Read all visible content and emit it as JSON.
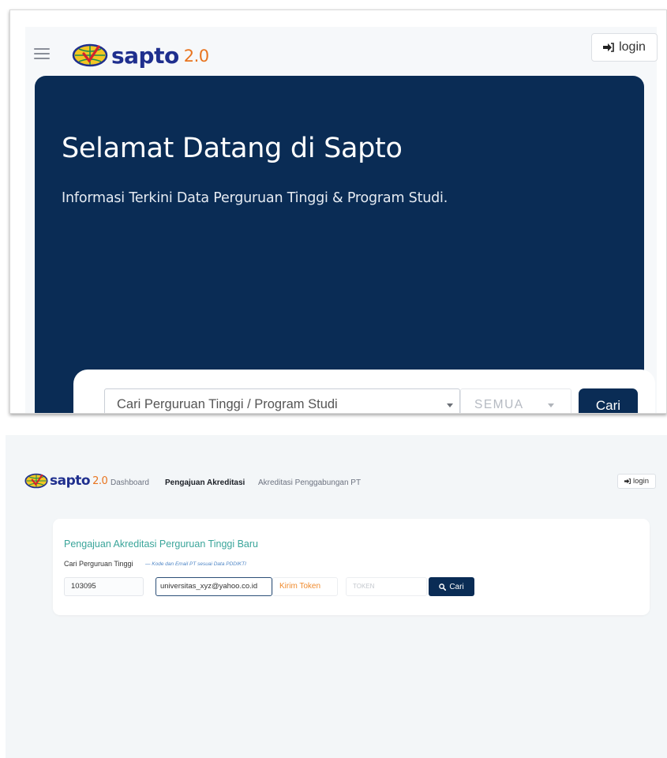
{
  "top_screen": {
    "brand": {
      "word": "sapto",
      "version": "2.0"
    },
    "login_label": "login",
    "hero": {
      "title": "Selamat Datang di Sapto",
      "subtitle": "Informasi Terkini Data Perguruan Tinggi & Program Studi."
    },
    "search": {
      "placeholder": "Cari Perguruan Tinggi / Program Studi",
      "filter_value": "SEMUA",
      "button_label": "Cari"
    },
    "icons": {
      "menu": "hamburger-menu-icon",
      "login": "sign-in-icon",
      "logo": "globe-check-logo-icon",
      "dropdown": "chevron-down-icon"
    },
    "colors": {
      "navy": "#0a2c55",
      "brand_blue": "#1f2f8e",
      "brand_orange": "#e8741f"
    }
  },
  "bottom_screen": {
    "brand": {
      "word": "sapto",
      "version": "2.0"
    },
    "nav": [
      "Dashboard",
      "Pengajuan Akreditasi",
      "Akreditasi Penggabungan PT"
    ],
    "active_nav": "Pengajuan Akreditasi",
    "login_label": "login",
    "card": {
      "title": "Pengajuan Akreditasi Perguruan Tinggi Baru",
      "label": "Cari Perguruan Tinggi",
      "hint": "— Kode dan Email PT sesuai Data PDDIKTI",
      "kode_value": "103095",
      "email_value": "universitas_xyz@yahoo.co.id",
      "send_token_label": "Kirim Token",
      "token_placeholder": "TOKEN",
      "search_label": "Cari"
    },
    "icons": {
      "search": "search-icon",
      "login": "sign-in-icon"
    },
    "colors": {
      "title_teal": "#3aa59a",
      "token_orange": "#f08a2c",
      "hint_blue": "#4f86c6"
    }
  }
}
